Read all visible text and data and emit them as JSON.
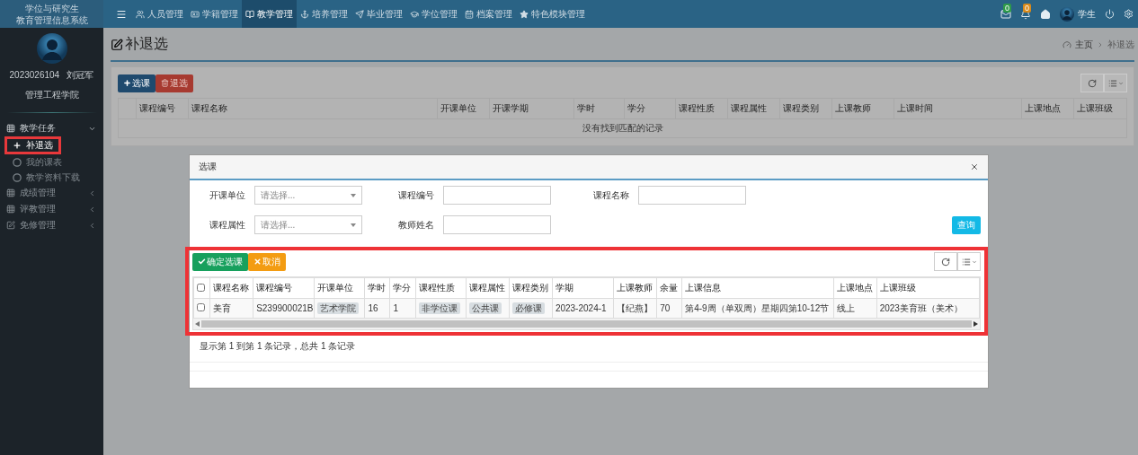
{
  "brand": {
    "line1": "学位与研究生",
    "line2": "教育管理信息系统"
  },
  "nav": {
    "items": [
      {
        "label": "人员管理",
        "selected": false
      },
      {
        "label": "学籍管理",
        "selected": false
      },
      {
        "label": "教学管理",
        "selected": true
      },
      {
        "label": "培养管理",
        "selected": false
      },
      {
        "label": "毕业管理",
        "selected": false
      },
      {
        "label": "学位管理",
        "selected": false
      },
      {
        "label": "档案管理",
        "selected": false
      },
      {
        "label": "特色模块管理",
        "selected": false
      }
    ]
  },
  "header_right": {
    "mail_badge": "0",
    "bell_badge": "0",
    "role": "学生"
  },
  "user": {
    "id": "2023026104",
    "name": "刘冠军",
    "college": "管理工程学院"
  },
  "sidebar": {
    "items": [
      {
        "label": "教学任务",
        "expanded": true,
        "children": [
          {
            "label": "补退选",
            "selected": true,
            "highlighted": true
          },
          {
            "label": "我的课表",
            "selected": false,
            "highlighted": false
          },
          {
            "label": "教学资料下载",
            "selected": false,
            "highlighted": false
          }
        ]
      },
      {
        "label": "成绩管理",
        "expanded": false
      },
      {
        "label": "评教管理",
        "expanded": false
      },
      {
        "label": "免修管理",
        "expanded": false
      }
    ]
  },
  "page": {
    "title": "补退选",
    "breadcrumb": [
      "主页",
      "补退选"
    ],
    "buttons": [
      {
        "label": "选课",
        "kind": "add"
      },
      {
        "label": "退选",
        "kind": "delete"
      }
    ],
    "table": {
      "columns": [
        "课程编号",
        "课程名称",
        "开课单位",
        "开课学期",
        "学时",
        "学分",
        "课程性质",
        "课程属性",
        "课程类别",
        "上课教师",
        "上课时间",
        "上课地点",
        "上课班级"
      ],
      "empty_message": "没有找到匹配的记录"
    }
  },
  "dialog": {
    "title": "选课",
    "filter_rows": [
      [
        {
          "label": "开课单位",
          "kind": "select",
          "placeholder": "请选择..."
        },
        {
          "label": "课程编号",
          "kind": "input"
        },
        {
          "label": "课程名称",
          "kind": "input"
        }
      ],
      [
        {
          "label": "课程属性",
          "kind": "select",
          "placeholder": "请选择..."
        },
        {
          "label": "教师姓名",
          "kind": "input"
        }
      ]
    ],
    "search_button": "查询",
    "section": {
      "highlighted": true,
      "buttons": [
        {
          "label": "确定选课",
          "kind": "confirm"
        },
        {
          "label": "取消",
          "kind": "cancel"
        }
      ],
      "table": {
        "header_checked": false,
        "columns": [
          "课程名称",
          "课程编号",
          "开课单位",
          "学时",
          "学分",
          "课程性质",
          "课程属性",
          "课程类别",
          "学期",
          "上课教师",
          "余量",
          "上课信息",
          "上课地点",
          "上课班级"
        ],
        "rows": [
          {
            "checked": false,
            "cells": [
              {
                "text": "美育",
                "kind": "text"
              },
              {
                "text": "S239900021B",
                "kind": "text"
              },
              {
                "text": "艺术学院",
                "kind": "tag"
              },
              {
                "text": "16",
                "kind": "text"
              },
              {
                "text": "1",
                "kind": "text"
              },
              {
                "text": "非学位课",
                "kind": "tag"
              },
              {
                "text": "公共课",
                "kind": "tag"
              },
              {
                "text": "必修课",
                "kind": "tag"
              },
              {
                "text": "2023-2024-1",
                "kind": "text"
              },
              {
                "text": "【纪燕】",
                "kind": "text"
              },
              {
                "text": "70",
                "kind": "text"
              },
              {
                "text": "第4-9周（单双周）星期四第10-12节",
                "kind": "text"
              },
              {
                "text": "线上",
                "kind": "text"
              },
              {
                "text": "2023美育班（美术）",
                "kind": "text"
              }
            ]
          }
        ]
      }
    },
    "footer": "显示第 1 到第 1 条记录，总共 1 条记录"
  }
}
